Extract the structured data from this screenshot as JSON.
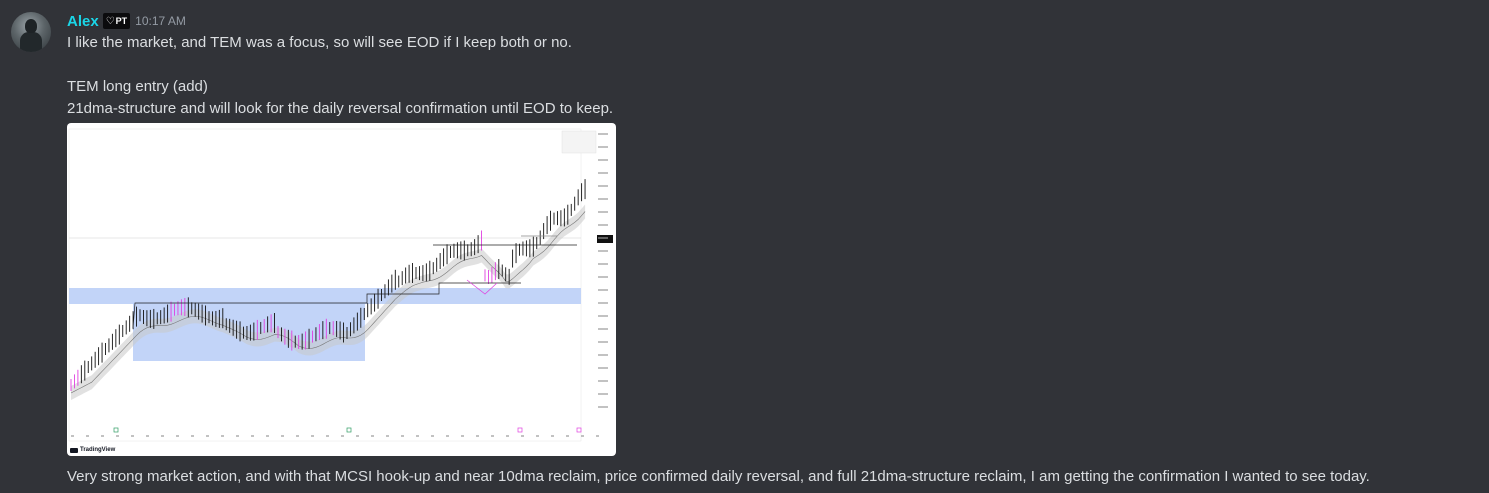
{
  "message": {
    "username": "Alex",
    "role_tag": "PT",
    "timestamp": "10:17 AM",
    "lines": [
      "I like the market, and TEM was a focus, so will see EOD if I keep both or no.",
      "TEM long entry (add)",
      "21dma-structure and will look for the daily reversal confirmation until EOD to keep.",
      "Very strong market action, and with that MCSI hook-up and near 10dma reclaim, price confirmed daily reversal, and full 21dma-structure reclaim, I am getting the confirmation I wanted to see today."
    ]
  },
  "attachment": {
    "watermark": "TradingView",
    "colors": {
      "zone": "#b7cdf7",
      "band": "#c8c8c8",
      "bar_up": "#111111",
      "bar_weak": "#e040e0",
      "accent": "#1ad6e8"
    },
    "icons": [
      "avatar-image",
      "shield-icon",
      "tradingview-logo-icon"
    ]
  }
}
